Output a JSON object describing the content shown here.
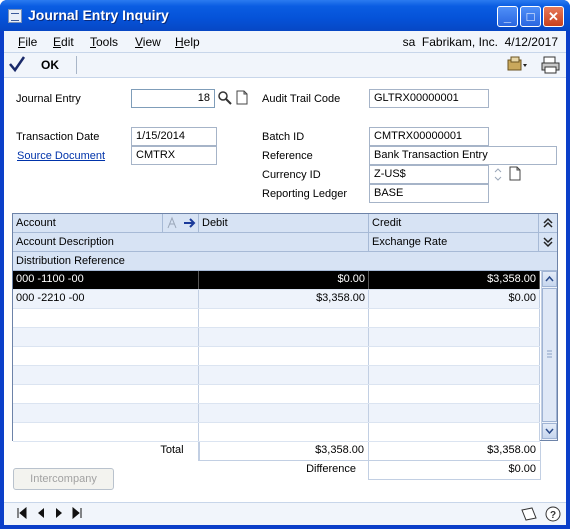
{
  "window": {
    "title": "Journal Entry Inquiry"
  },
  "menu": {
    "items": [
      "File",
      "Edit",
      "Tools",
      "View",
      "Help"
    ],
    "context": "sa  Fabrikam, Inc.  4/12/2017"
  },
  "toolbar": {
    "ok_label": "OK"
  },
  "header": {
    "journal_entry_label": "Journal Entry",
    "journal_entry_value": "18",
    "audit_trail_label": "Audit Trail Code",
    "audit_trail_value": "GLTRX00000001",
    "transaction_date_label": "Transaction Date",
    "transaction_date_value": "1/15/2014",
    "batch_id_label": "Batch ID",
    "batch_id_value": "CMTRX00000001",
    "source_document_label": "Source Document",
    "source_document_value": "CMTRX",
    "reference_label": "Reference",
    "reference_value": "Bank Transaction Entry",
    "currency_id_label": "Currency ID",
    "currency_id_value": "Z-US$",
    "reporting_ledger_label": "Reporting Ledger",
    "reporting_ledger_value": "BASE"
  },
  "grid": {
    "headers": {
      "account": "Account",
      "debit": "Debit",
      "credit": "Credit",
      "account_description": "Account Description",
      "exchange_rate": "Exchange Rate",
      "distribution_reference": "Distribution Reference"
    },
    "rows": [
      {
        "account": "000 -1100 -00",
        "debit": "$0.00",
        "credit": "$3,358.00",
        "selected": true
      },
      {
        "account": "000 -2210 -00",
        "debit": "$3,358.00",
        "credit": "$0.00",
        "selected": false
      }
    ]
  },
  "totals": {
    "total_label": "Total",
    "total_debit": "$3,358.00",
    "total_credit": "$3,358.00",
    "difference_label": "Difference",
    "difference_value": "$0.00"
  },
  "buttons": {
    "intercompany": "Intercompany"
  },
  "colors": {
    "title_bar": "#0552d8",
    "header_bg": "#d7e3f4",
    "selected_row": "#000000"
  }
}
